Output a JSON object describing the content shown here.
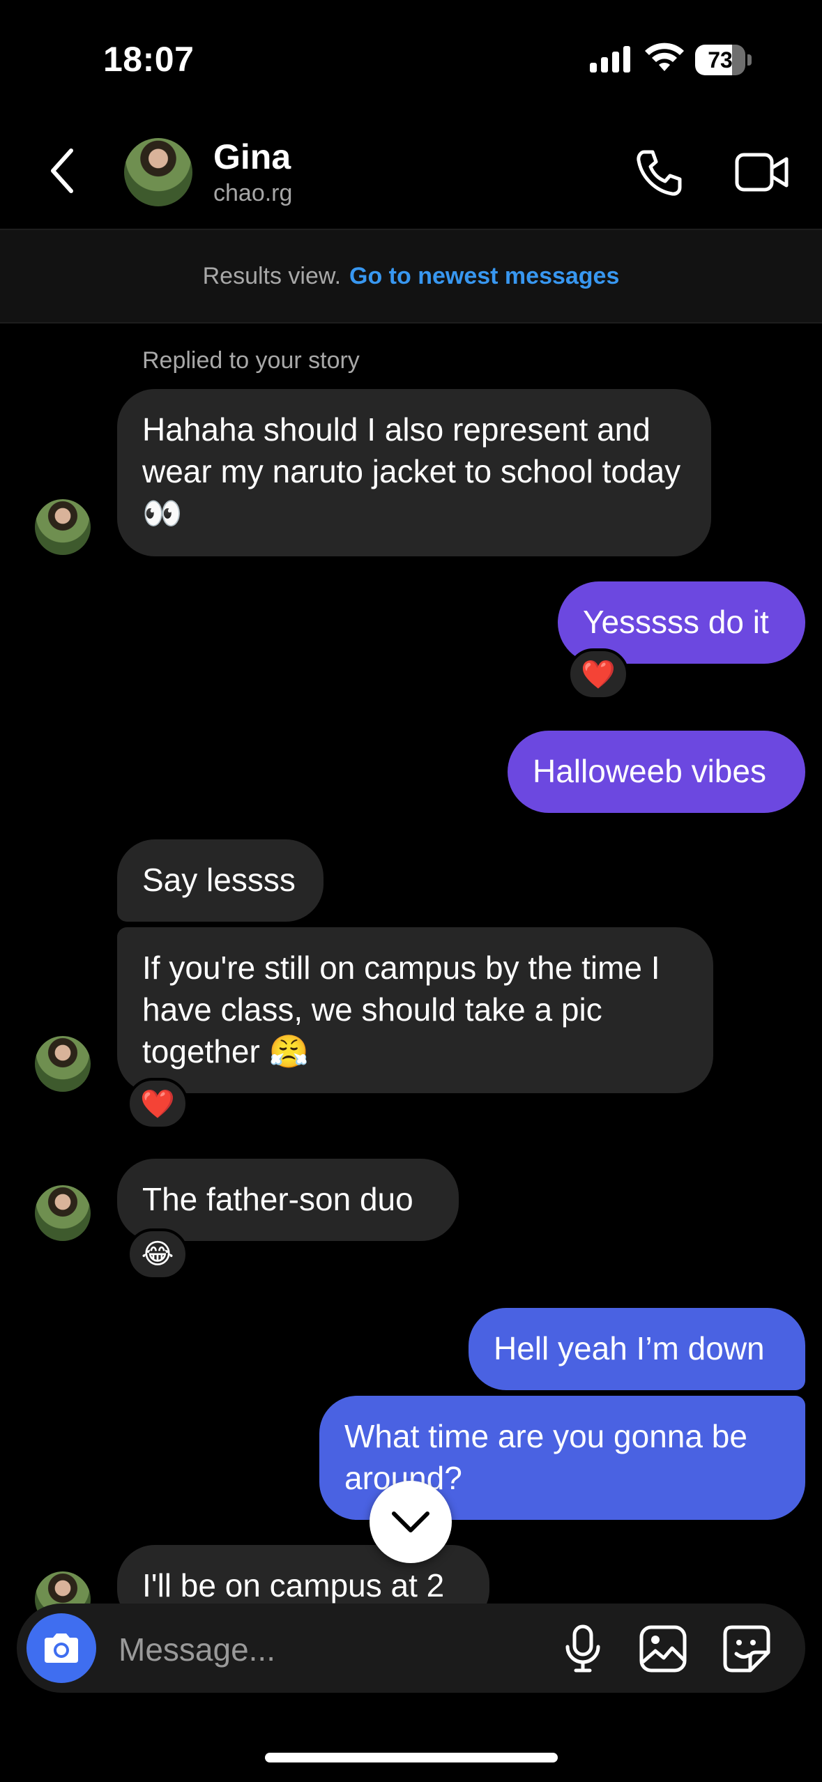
{
  "status_bar": {
    "time": "18:07",
    "battery": "73",
    "battery_level": 0.73
  },
  "header": {
    "name": "Gina",
    "username": "chao.rg"
  },
  "banner": {
    "label": "Results view.",
    "link": "Go to newest messages"
  },
  "messages": [
    {
      "from": "them",
      "note": "Replied to your story",
      "text": "Hahaha should I also represent and wear my naruto jacket to school today 👀"
    },
    {
      "from": "me",
      "text": "Yesssss do it",
      "reaction": "❤️"
    },
    {
      "from": "me",
      "text": "Halloweeb vibes"
    },
    {
      "from": "them",
      "text": "Say lessss"
    },
    {
      "from": "them",
      "text": "If you're still on campus by the time I have class, we should take a pic together 😤",
      "reaction": "❤️"
    },
    {
      "from": "them",
      "text": "The father-son duo",
      "reaction": "😂"
    },
    {
      "from": "me",
      "text": "Hell yeah I’m down"
    },
    {
      "from": "me",
      "text": "What time are you gonna be around?"
    },
    {
      "from": "them",
      "text": "I'll be on campus at 2"
    }
  ],
  "composer": {
    "placeholder": "Message..."
  },
  "icons": {
    "back": "chevron-left-icon",
    "call": "phone-icon",
    "video": "video-camera-icon",
    "scroll": "chevron-down-icon",
    "camera": "camera-icon",
    "mic": "microphone-icon",
    "gallery": "image-icon",
    "sticker": "sticker-icon"
  },
  "colors": {
    "incoming": "#262626",
    "outgoing_purple": "#6c48e0",
    "outgoing_blue": "#4a62e2",
    "link": "#3897f0",
    "camera_button": "#3f6ef0"
  }
}
